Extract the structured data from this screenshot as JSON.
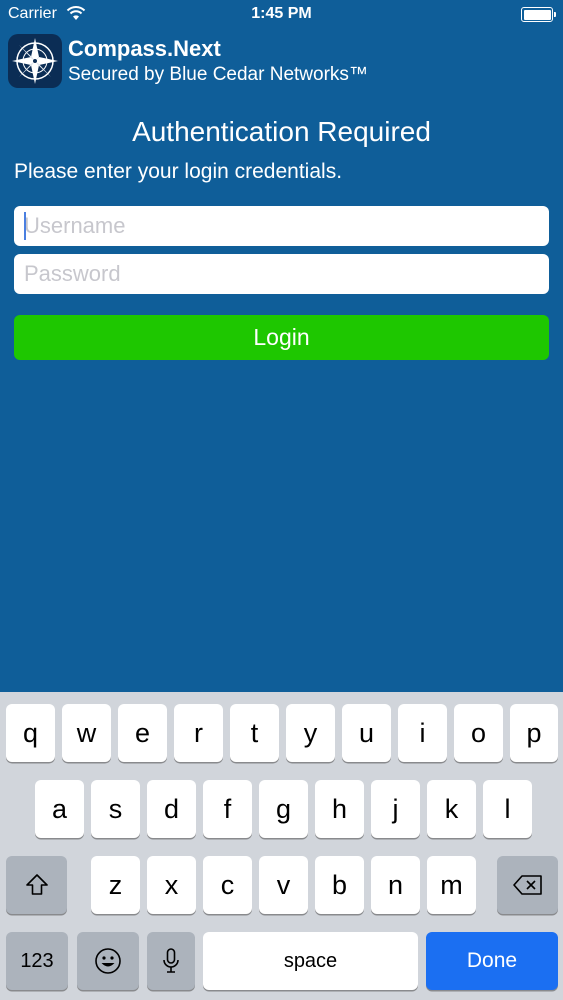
{
  "status_bar": {
    "carrier": "Carrier",
    "time": "1:45 PM",
    "icons": [
      "wifi-icon",
      "battery-icon"
    ]
  },
  "app": {
    "name": "Compass.Next",
    "subtitle": "Secured by Blue Cedar Networks™",
    "icon": "compass-icon"
  },
  "auth": {
    "title": "Authentication Required",
    "instructions": "Please enter your login credentials.",
    "username_placeholder": "Username",
    "username_value": "",
    "password_placeholder": "Password",
    "password_value": "",
    "login_label": "Login"
  },
  "keyboard": {
    "row1": [
      "q",
      "w",
      "e",
      "r",
      "t",
      "y",
      "u",
      "i",
      "o",
      "p"
    ],
    "row2": [
      "a",
      "s",
      "d",
      "f",
      "g",
      "h",
      "j",
      "k",
      "l"
    ],
    "row3": [
      "z",
      "x",
      "c",
      "v",
      "b",
      "n",
      "m"
    ],
    "numbers_label": "123",
    "space_label": "space",
    "done_label": "Done",
    "icons": [
      "shift-icon",
      "backspace-icon",
      "emoji-icon",
      "microphone-icon"
    ]
  },
  "colors": {
    "background": "#0f5e99",
    "login_button": "#1ec700",
    "done_key": "#1b6ff2",
    "keyboard_bg": "#d1d5db"
  }
}
